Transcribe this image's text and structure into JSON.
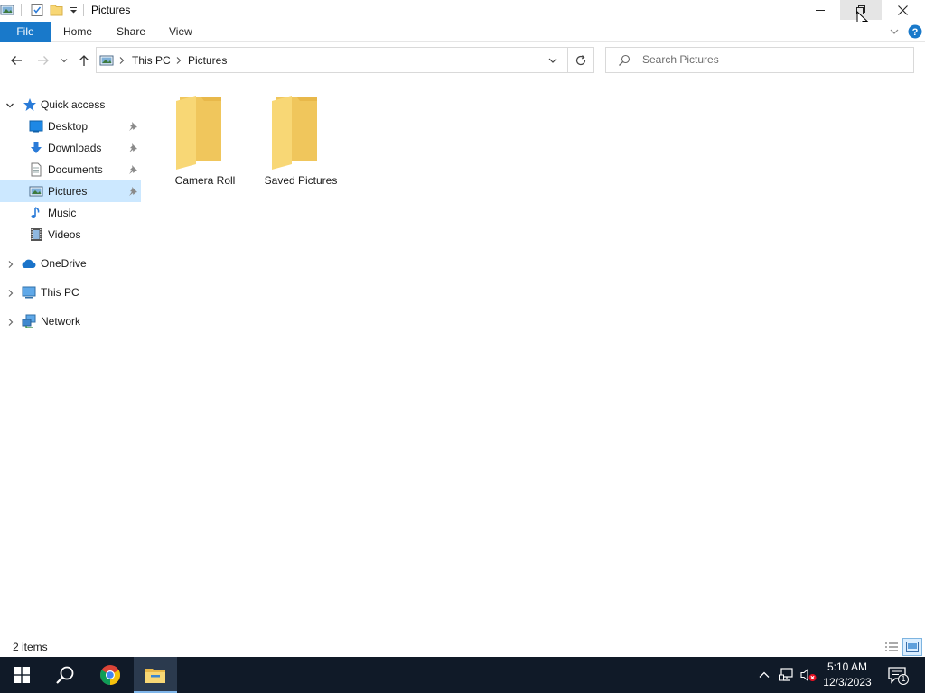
{
  "window": {
    "title": "Pictures",
    "icons": [
      "pictures-icon",
      "properties-icon",
      "new-folder-icon",
      "customize-qat-icon"
    ]
  },
  "ribbon": {
    "tabs": [
      {
        "label": "File",
        "active": true
      },
      {
        "label": "Home"
      },
      {
        "label": "Share"
      },
      {
        "label": "View"
      }
    ]
  },
  "address": {
    "crumbs": [
      "This PC",
      "Pictures"
    ]
  },
  "search": {
    "placeholder": "Search Pictures"
  },
  "nav": {
    "quick_access": "Quick access",
    "items": [
      {
        "label": "Desktop",
        "icon": "desktop-icon",
        "pinned": true
      },
      {
        "label": "Downloads",
        "icon": "downloads-icon",
        "pinned": true
      },
      {
        "label": "Documents",
        "icon": "documents-icon",
        "pinned": true
      },
      {
        "label": "Pictures",
        "icon": "pictures-icon",
        "pinned": true,
        "selected": true
      },
      {
        "label": "Music",
        "icon": "music-icon"
      },
      {
        "label": "Videos",
        "icon": "videos-icon"
      }
    ],
    "roots": [
      {
        "label": "OneDrive",
        "icon": "onedrive-icon"
      },
      {
        "label": "This PC",
        "icon": "this-pc-icon"
      },
      {
        "label": "Network",
        "icon": "network-icon"
      }
    ]
  },
  "content": {
    "folders": [
      {
        "name": "Camera Roll"
      },
      {
        "name": "Saved Pictures"
      }
    ]
  },
  "status": {
    "item_count": "2 items"
  },
  "taskbar": {
    "time": "5:10 AM",
    "date": "12/3/2023",
    "notifications": "1"
  },
  "colors": {
    "accent": "#1979ca",
    "selection": "#cce8ff",
    "folder": "#f8d775",
    "taskbar": "#101a28"
  }
}
